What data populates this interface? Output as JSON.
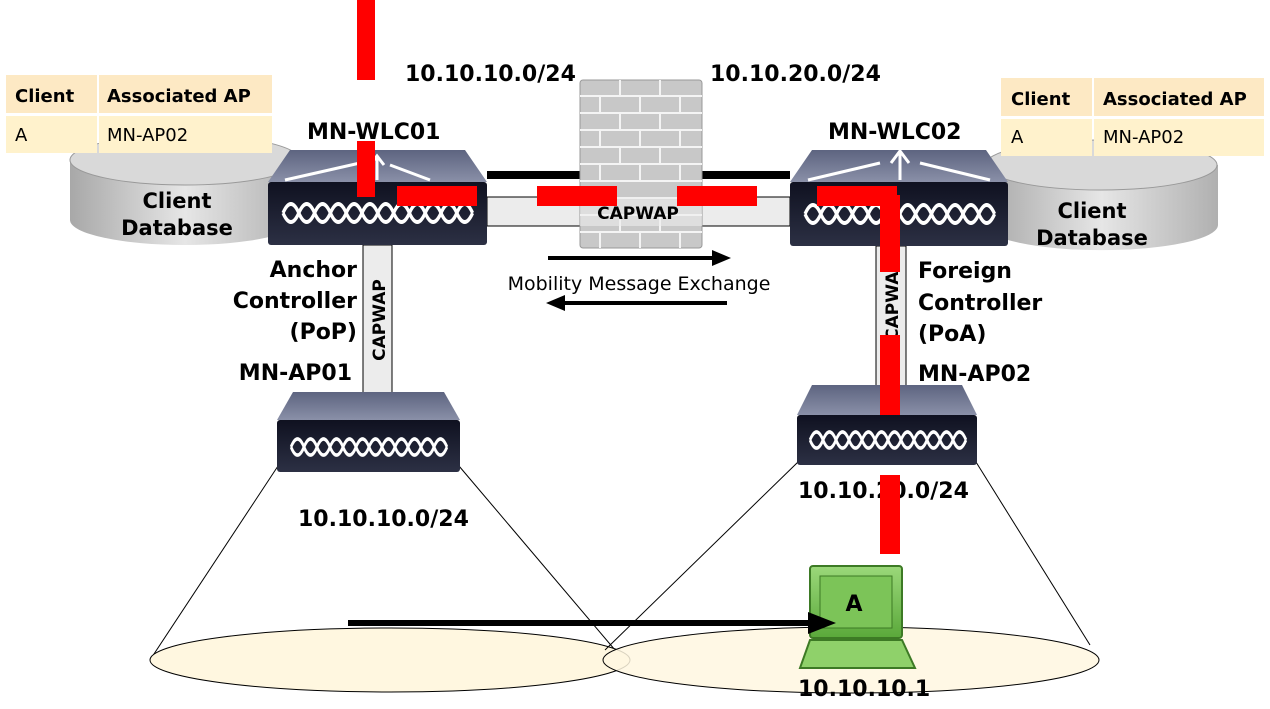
{
  "subnets": {
    "left_top": "10.10.10.0/24",
    "right_top": "10.10.20.0/24",
    "ap01": "10.10.10.0/24",
    "ap02": "10.10.20.0/24"
  },
  "controllers": {
    "wlc01": {
      "name": "MN-WLC01",
      "role": [
        "Anchor",
        "Controller",
        "(PoP)"
      ]
    },
    "wlc02": {
      "name": "MN-WLC02",
      "role": [
        "Foreign",
        "Controller",
        "(PoA)"
      ]
    }
  },
  "aps": {
    "ap01": "MN-AP01",
    "ap02": "MN-AP02"
  },
  "database_label": [
    "Client",
    "Database"
  ],
  "tables": {
    "headers": [
      "Client",
      "Associated AP"
    ],
    "left_row": [
      "A",
      "MN-AP02"
    ],
    "right_row": [
      "A",
      "MN-AP02"
    ]
  },
  "tunnel_label": "CAPWAP",
  "mobility_label": "Mobility Message Exchange",
  "client": {
    "name": "A",
    "ip": "10.10.10.1"
  },
  "colors": {
    "redaction": "#ff0000",
    "table_header": "#fde9c4",
    "table_row": "#fff2cc",
    "coverage": "#fff7e0",
    "laptop": "#8fd16a"
  }
}
